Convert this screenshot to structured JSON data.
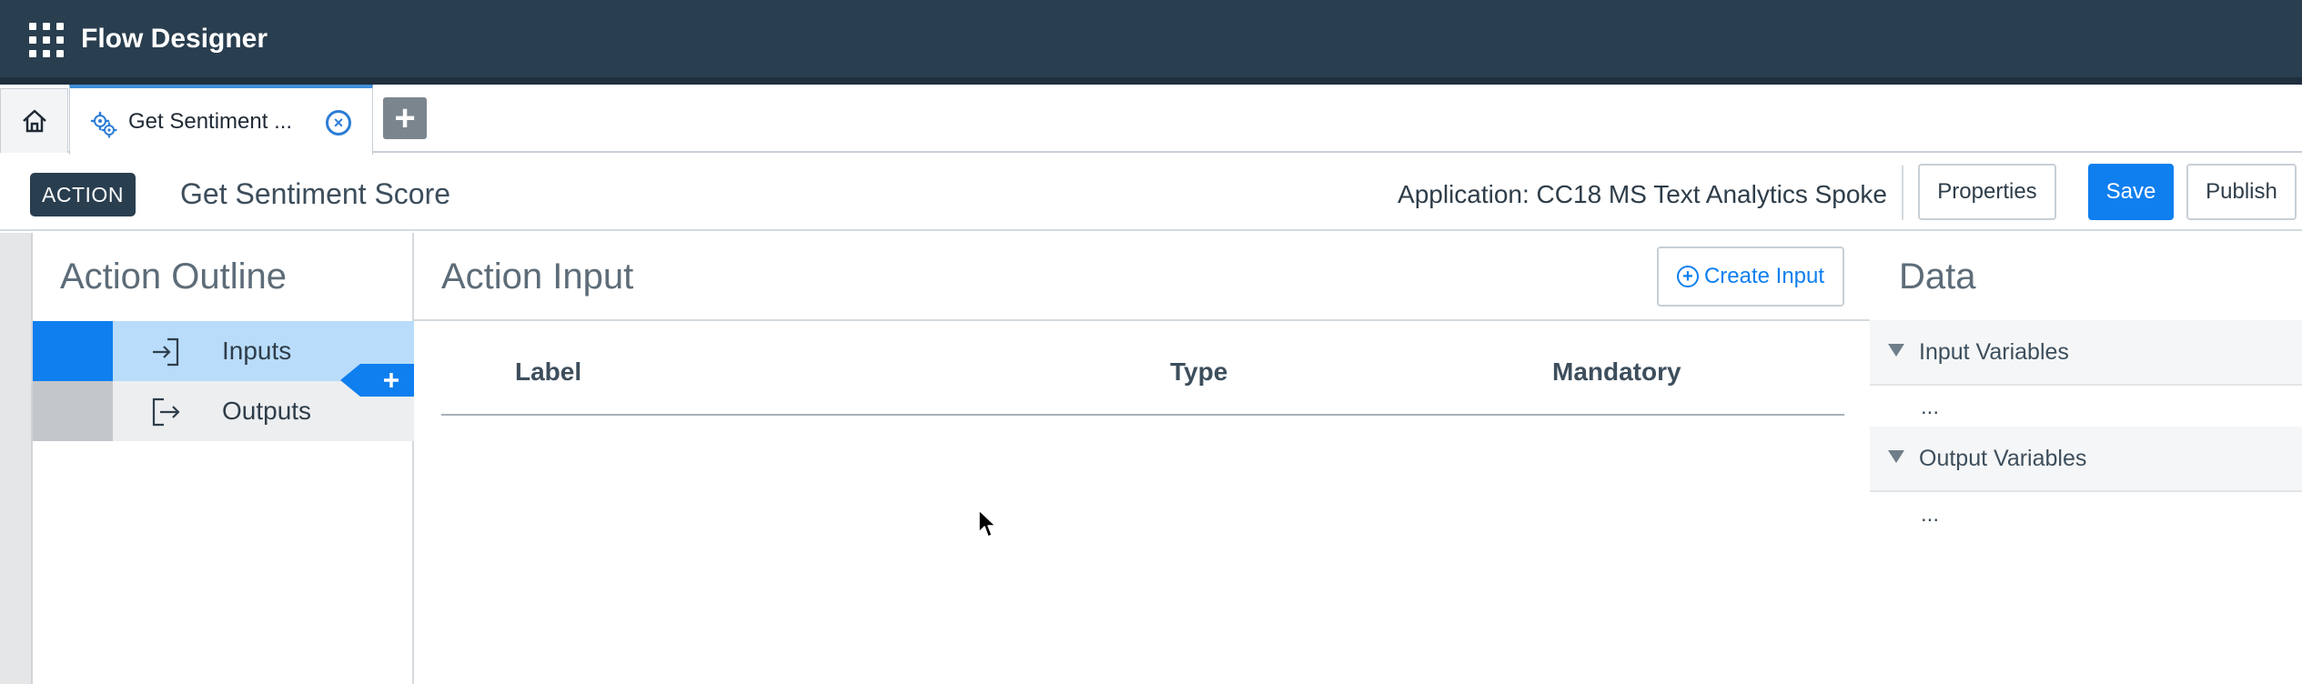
{
  "header": {
    "app_title": "Flow Designer",
    "menu_icon": "grid-icon"
  },
  "tabs": {
    "home_icon": "home-icon",
    "active_tab": {
      "label": "Get Sentiment ...",
      "icon": "gear-icon",
      "close_icon": "close-circle-icon"
    },
    "add_tab_label": "+"
  },
  "action_bar": {
    "badge": "ACTION",
    "action_name": "Get Sentiment Score",
    "application": "Application: CC18 MS Text Analytics Spoke",
    "buttons": {
      "properties": "Properties",
      "save": "Save",
      "publish": "Publish"
    }
  },
  "outline": {
    "title": "Action Outline",
    "items": [
      {
        "label": "Inputs",
        "icon": "input-arrow-icon",
        "selected": true
      },
      {
        "label": "Outputs",
        "icon": "output-arrow-icon",
        "selected": false
      }
    ],
    "insert_icon": "plus-icon"
  },
  "action_input": {
    "title": "Action Input",
    "create_button": "Create Input",
    "columns": [
      "Label",
      "Type",
      "Mandatory"
    ]
  },
  "data_panel": {
    "title": "Data",
    "sections": [
      {
        "label": "Input Variables",
        "content": "..."
      },
      {
        "label": "Output Variables",
        "content": "..."
      }
    ]
  },
  "colors": {
    "header_bg": "#293e4f",
    "primary": "#0f7fef",
    "selected_bg": "#b9dcfb"
  }
}
